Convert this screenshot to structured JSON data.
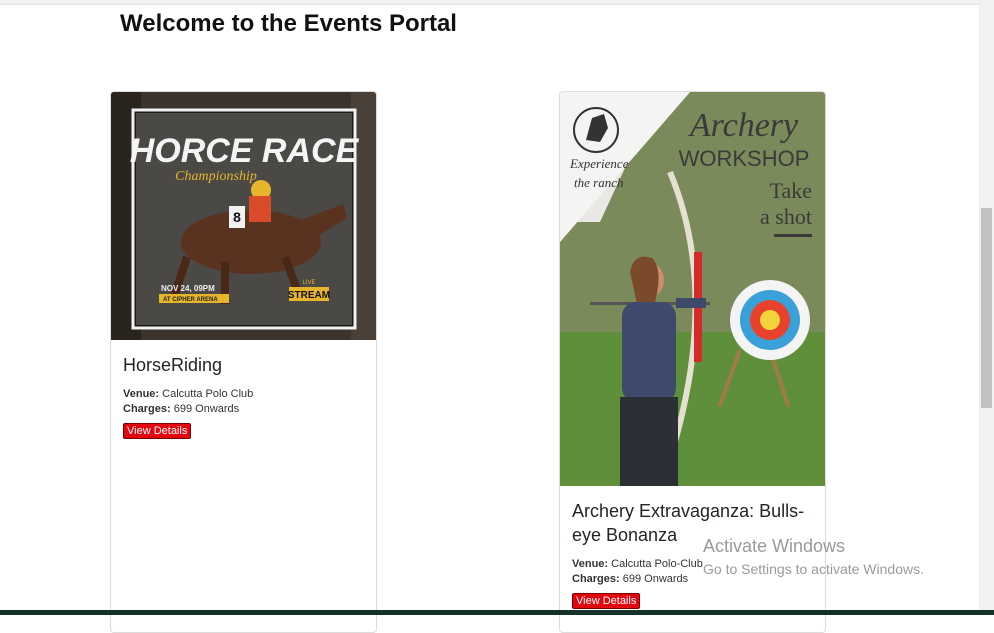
{
  "page": {
    "title": "Welcome to the Events Portal"
  },
  "events": [
    {
      "name": "HorseRiding",
      "venue_label": "Venue:",
      "venue": "Calcutta Polo Club",
      "charges_label": "Charges:",
      "charges": "699 Onwards",
      "button_label": "View Details",
      "poster": {
        "headline": "HORCE RACE",
        "script": "Championship",
        "date": "NOV 24, 09PM",
        "place": "AT CIPHER ARENA",
        "badge_top": "LIVE",
        "badge": "STREAM",
        "number": "8"
      }
    },
    {
      "name": "Archery Extravaganza: Bulls-eye Bonanza",
      "venue_label": "Venue:",
      "venue": "Calcutta Polo-Club",
      "charges_label": "Charges:",
      "charges": "699 Onwards",
      "button_label": "View Details",
      "poster": {
        "title": "Archery",
        "subtitle": "WORKSHOP",
        "tagline_1": "Take",
        "tagline_2": "a shot",
        "corner_1": "Experience",
        "corner_2": "the ranch"
      }
    }
  ],
  "watermark": {
    "line1": "Activate Windows",
    "line2": "Go to Settings to activate Windows."
  },
  "colors": {
    "button": "#e3060f",
    "taskbar": "#17302a"
  }
}
